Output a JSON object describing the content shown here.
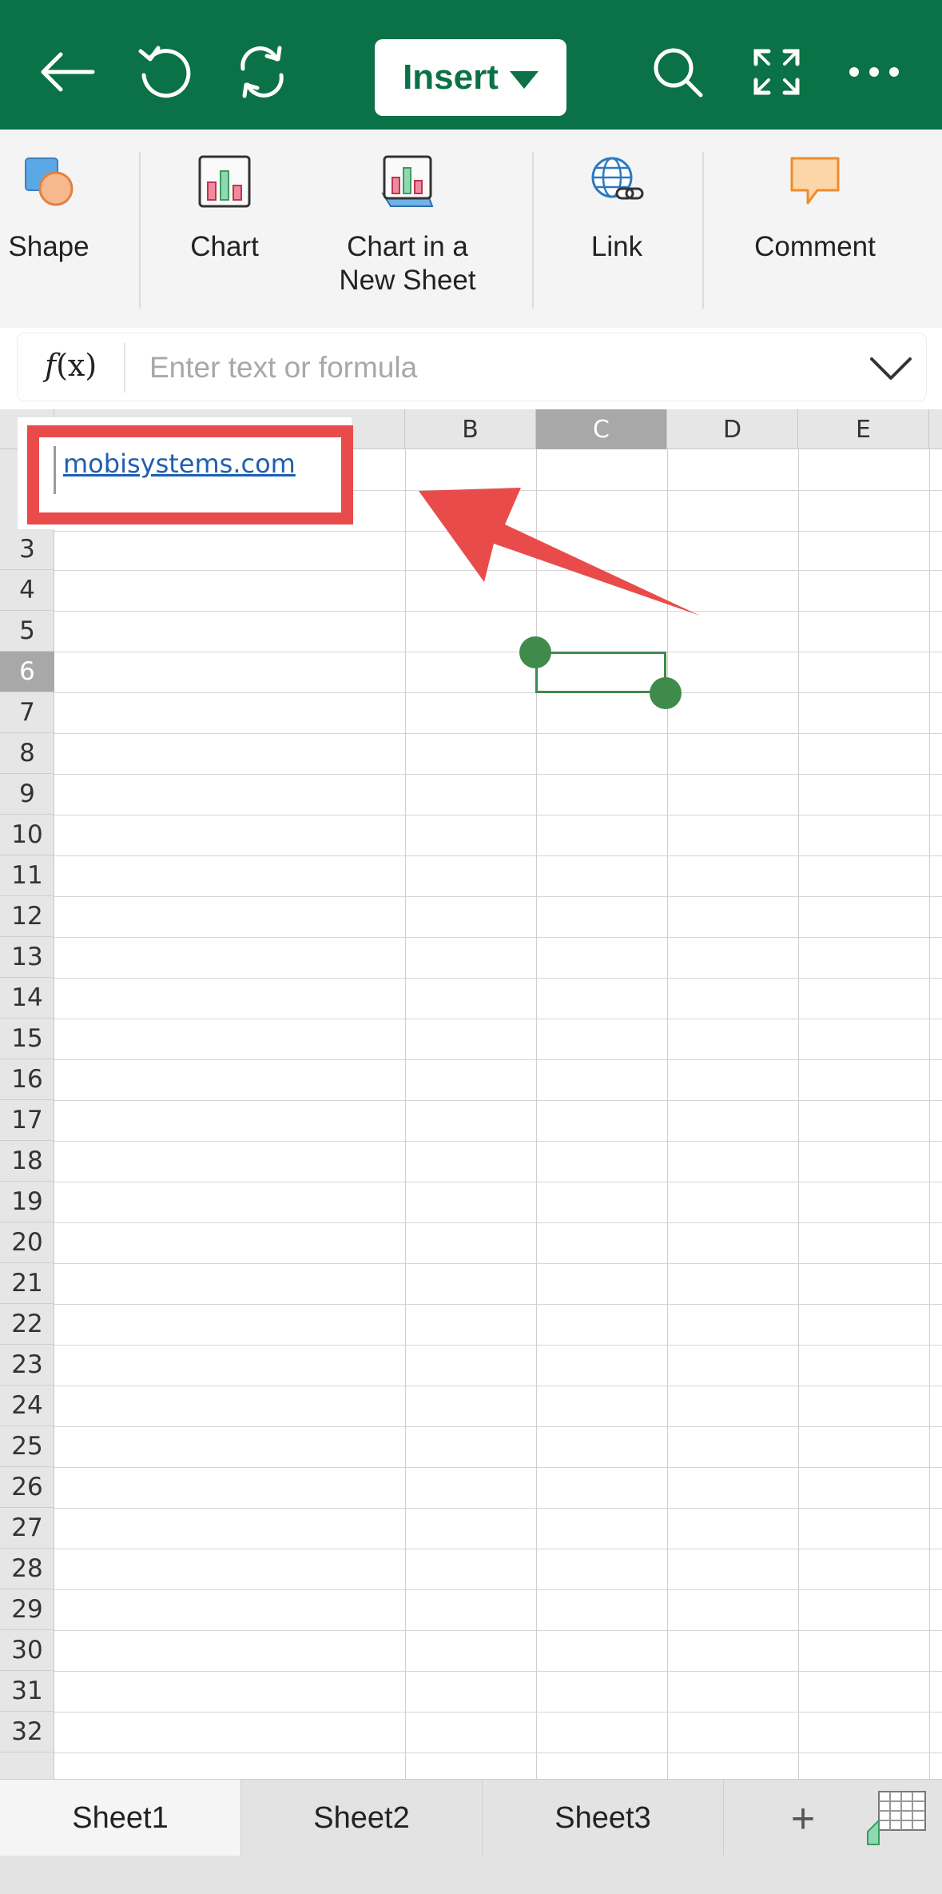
{
  "toolbar": {
    "back_icon": "back-arrow-icon",
    "undo_icon": "undo-icon",
    "redo_icon": "redo-icon",
    "menu_label": "Insert",
    "search_icon": "search-icon",
    "fullscreen_icon": "fullscreen-icon",
    "more_icon": "more-icon",
    "brand_color": "#0b7146"
  },
  "ribbon": {
    "items": [
      {
        "label": "Shape",
        "icon": "shape-icon"
      },
      {
        "label": "Chart",
        "icon": "chart-icon"
      },
      {
        "label": "Chart in a\nNew Sheet",
        "icon": "chart-new-sheet-icon"
      },
      {
        "label": "Link",
        "icon": "link-icon"
      },
      {
        "label": "Comment",
        "icon": "comment-icon"
      }
    ]
  },
  "formula_bar": {
    "fx_label": "f",
    "fx_suffix": "(x)",
    "placeholder": "Enter text or formula",
    "value": ""
  },
  "grid": {
    "columns": [
      "B",
      "C",
      "D",
      "E"
    ],
    "selected_column": "C",
    "rows": [
      "3",
      "4",
      "5",
      "6",
      "7",
      "8",
      "9",
      "10",
      "11",
      "12",
      "13",
      "14",
      "15",
      "16",
      "17",
      "18",
      "19",
      "20",
      "21",
      "22",
      "23",
      "24",
      "25",
      "26",
      "27",
      "28",
      "29",
      "30",
      "31",
      "32"
    ],
    "selected_row": "6",
    "selection_color": "#3e8b4c"
  },
  "callout": {
    "link_text": "mobisystems.com",
    "highlight_color": "#e94b4b"
  },
  "sheets": {
    "tabs": [
      "Sheet1",
      "Sheet2",
      "Sheet3"
    ],
    "active": "Sheet1",
    "add_label": "+"
  }
}
